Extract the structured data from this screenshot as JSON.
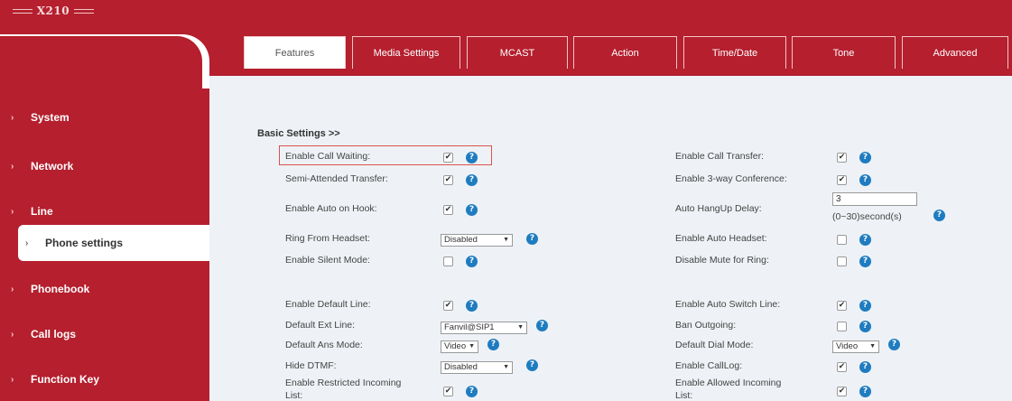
{
  "header": {
    "model": "X210"
  },
  "sidebar": {
    "items": [
      {
        "label": "System"
      },
      {
        "label": "Network"
      },
      {
        "label": "Line"
      },
      {
        "label": "Phone settings"
      },
      {
        "label": "Phonebook"
      },
      {
        "label": "Call logs"
      },
      {
        "label": "Function Key"
      }
    ],
    "active_index": 3
  },
  "tabs": [
    {
      "label": "Features"
    },
    {
      "label": "Media Settings"
    },
    {
      "label": "MCAST"
    },
    {
      "label": "Action"
    },
    {
      "label": "Time/Date"
    },
    {
      "label": "Tone"
    },
    {
      "label": "Advanced"
    }
  ],
  "section_title": "Basic Settings >>",
  "left": {
    "call_waiting": {
      "label": "Enable Call Waiting:",
      "checked": true
    },
    "semi_attended": {
      "label": "Semi-Attended Transfer:",
      "checked": true
    },
    "auto_on_hook": {
      "label": "Enable Auto on Hook:",
      "checked": true
    },
    "ring_headset": {
      "label": "Ring From Headset:",
      "value": "Disabled"
    },
    "silent_mode": {
      "label": "Enable Silent Mode:",
      "checked": false
    },
    "default_line": {
      "label": "Enable Default Line:",
      "checked": true
    },
    "default_ext": {
      "label": "Default Ext Line:",
      "value": "Fanvil@SIP1"
    },
    "default_ans": {
      "label": "Default Ans Mode:",
      "value": "Video"
    },
    "hide_dtmf": {
      "label": "Hide DTMF:",
      "value": "Disabled"
    },
    "restricted_incoming": {
      "label": "Enable Restricted Incoming",
      "label2": "List:",
      "checked": true
    }
  },
  "right": {
    "call_transfer": {
      "label": "Enable Call Transfer:",
      "checked": true
    },
    "three_way": {
      "label": "Enable 3-way Conference:",
      "checked": true
    },
    "auto_hangup": {
      "label": "Auto HangUp Delay:",
      "value": "3",
      "hint": "(0~30)second(s)"
    },
    "auto_headset": {
      "label": "Enable Auto Headset:",
      "checked": false
    },
    "mute_ring": {
      "label": "Disable Mute for Ring:",
      "checked": false
    },
    "auto_switch": {
      "label": "Enable Auto Switch Line:",
      "checked": true
    },
    "ban_outgoing": {
      "label": "Ban Outgoing:",
      "checked": false
    },
    "dial_mode": {
      "label": "Default Dial Mode:",
      "value": "Video"
    },
    "calllog": {
      "label": "Enable CallLog:",
      "checked": true
    },
    "allowed_incoming": {
      "label": "Enable Allowed Incoming",
      "label2": "List:",
      "checked": true
    }
  },
  "icons": {
    "help": "?",
    "check": "✔",
    "caret": "▼",
    "arrow": "›"
  },
  "colors": {
    "brand_red": "#b51f2e",
    "help_blue": "#1f7cc0",
    "panel_bg": "#eef2f6",
    "highlight": "#d9534f"
  }
}
